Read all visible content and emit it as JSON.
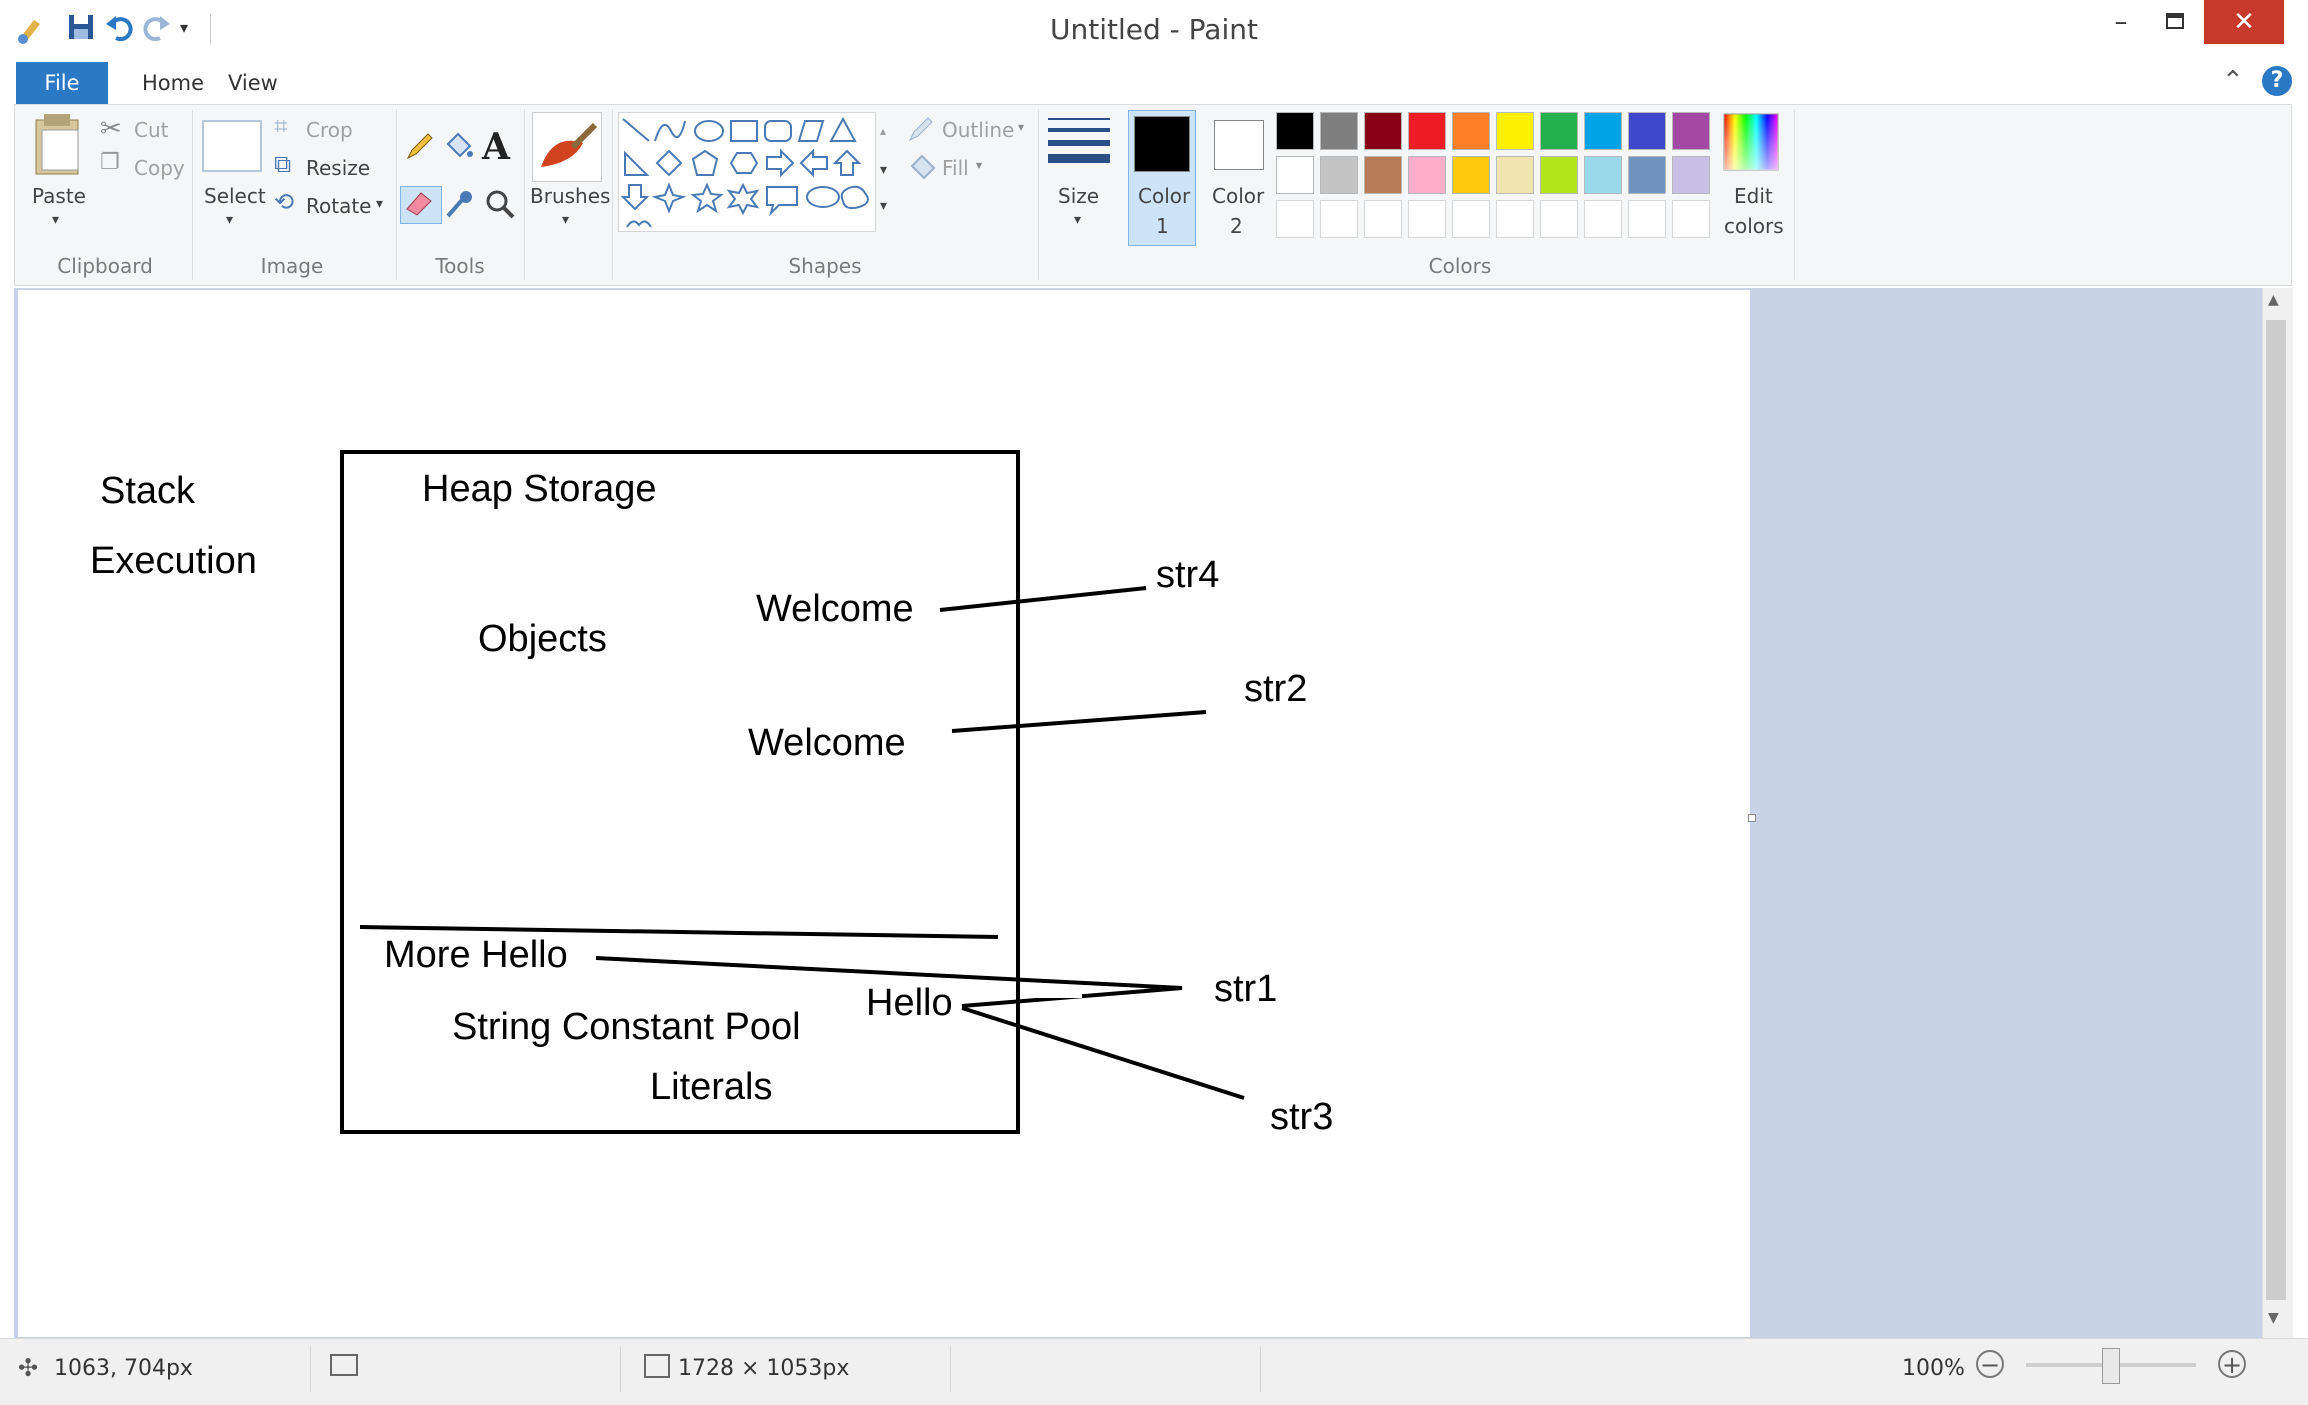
{
  "window": {
    "title": "Untitled - Paint"
  },
  "quick_access": {
    "icons": [
      "paint-app-icon",
      "save-icon",
      "undo-icon",
      "redo-icon",
      "customize-arrow-icon"
    ]
  },
  "tabs": [
    {
      "label": "File"
    },
    {
      "label": "Home"
    },
    {
      "label": "View"
    }
  ],
  "ribbon": {
    "clipboard": {
      "paste": "Paste",
      "cut": "Cut",
      "copy": "Copy",
      "group": "Clipboard"
    },
    "image": {
      "select": "Select",
      "crop": "Crop",
      "resize": "Resize",
      "rotate": "Rotate",
      "group": "Image"
    },
    "tools": {
      "group": "Tools"
    },
    "brushes": {
      "label": "Brushes"
    },
    "shapes": {
      "outline": "Outline",
      "fill": "Fill",
      "group": "Shapes"
    },
    "size": {
      "label": "Size"
    },
    "color1": {
      "line1": "Color",
      "line2": "1",
      "value": "#000000"
    },
    "color2": {
      "line1": "Color",
      "line2": "2",
      "value": "#ffffff"
    },
    "colors": {
      "group": "Colors",
      "edit_line1": "Edit",
      "edit_line2": "colors",
      "row1": [
        "#000000",
        "#7f7f7f",
        "#880015",
        "#ed1c24",
        "#ff7f27",
        "#fff200",
        "#22b14c",
        "#00a2e8",
        "#3f48cc",
        "#a349a4"
      ],
      "row2": [
        "#ffffff",
        "#c3c3c3",
        "#b97a57",
        "#ffaec9",
        "#ffc90e",
        "#efe4b0",
        "#b5e61d",
        "#99d9ea",
        "#7092be",
        "#c8bfe7"
      ]
    }
  },
  "canvas": {
    "texts": {
      "stack": "Stack",
      "execution": "Execution",
      "heap_storage": "Heap Storage",
      "objects": "Objects",
      "welcome_1": "Welcome",
      "welcome_2": "Welcome",
      "str4": "str4",
      "str2": "str2",
      "more_hello": "More Hello",
      "hello": "Hello",
      "str1": "str1",
      "str3": "str3",
      "string_constant_pool": "String Constant Pool",
      "literals": "Literals"
    }
  },
  "status": {
    "cursor_pos": "1063, 704px",
    "canvas_size": "1728 × 1053px",
    "zoom": "100%"
  }
}
